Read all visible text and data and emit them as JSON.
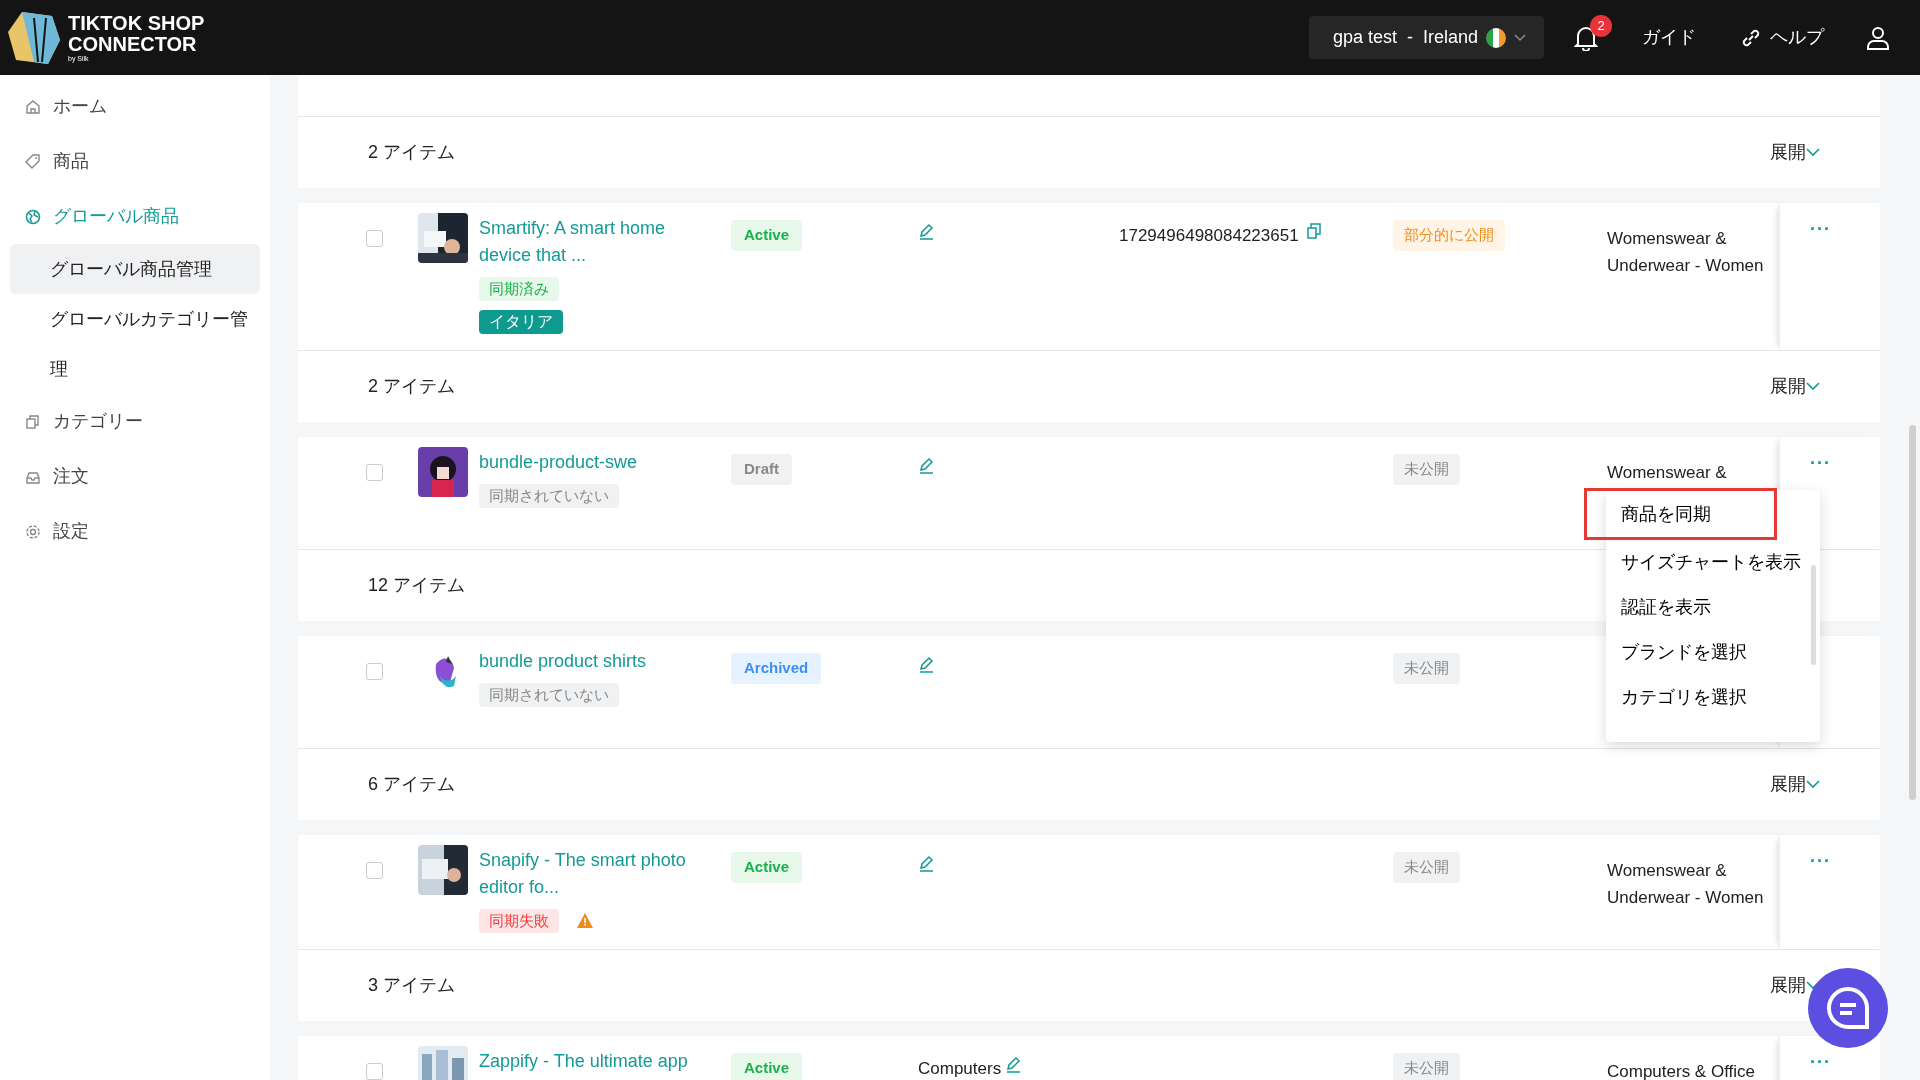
{
  "header": {
    "logo_line1": "TIKTOK SHOP",
    "logo_line2": "CONNECTOR",
    "logo_tagline": "by Silk",
    "store": "gpa test  -  Ireland",
    "notification_count": "2",
    "guide": "ガイド",
    "help": "ヘルプ"
  },
  "sidebar": {
    "items": [
      {
        "label": "ホーム",
        "selected": false
      },
      {
        "label": "商品",
        "selected": false
      },
      {
        "label": "グローバル商品",
        "selected": true,
        "expanded": true,
        "children": [
          {
            "label": "グローバル商品管理",
            "selected": true
          },
          {
            "label": "グローバルカテゴリー管理",
            "selected": false
          }
        ]
      },
      {
        "label": "カテゴリー",
        "selected": false
      },
      {
        "label": "注文",
        "selected": false
      },
      {
        "label": "設定",
        "selected": false
      }
    ]
  },
  "groups": [
    {
      "count": "2 アイテム",
      "expand": "展開",
      "product": {
        "name": "Smartify: A smart home device that ...",
        "checked": false,
        "tags": [
          {
            "label": "同期済み",
            "kind": "synced"
          },
          {
            "label": "イタリア",
            "kind": "country"
          }
        ],
        "status": {
          "label": "Active",
          "kind": "active"
        },
        "id": "1729496498084223651",
        "publish": {
          "label": "部分的に公開",
          "kind": "partial"
        },
        "category": "Womenswear & Underwear - Women",
        "more": "···"
      }
    },
    {
      "count": "2 アイテム",
      "expand": "展開",
      "product": {
        "name": "bundle-product-swe",
        "checked": false,
        "tags": [
          {
            "label": "同期されていない",
            "kind": "not_synced"
          }
        ],
        "status": {
          "label": "Draft",
          "kind": "draft"
        },
        "publish": {
          "label": "未公開",
          "kind": "unpublished"
        },
        "category": "Womenswear &",
        "more": "···",
        "menu": {
          "items": [
            {
              "label": "商品を同期",
              "highlighted": true
            },
            {
              "label": "サイズチャートを表示",
              "highlighted": false
            },
            {
              "label": "認証を表示",
              "highlighted": false
            },
            {
              "label": "ブランドを選択",
              "highlighted": false
            },
            {
              "label": "カテゴリを選択",
              "highlighted": false
            }
          ]
        }
      }
    },
    {
      "count": "12 アイテム",
      "product": {
        "name": "bundle product shirts",
        "checked": false,
        "tags": [
          {
            "label": "同期されていない",
            "kind": "not_synced"
          }
        ],
        "status": {
          "label": "Archived",
          "kind": "archived"
        },
        "publish": {
          "label": "未公開",
          "kind": "unpublished"
        }
      }
    },
    {
      "count": "6 アイテム",
      "expand": "展開",
      "product": {
        "name": "Snapify - The smart photo editor fo...",
        "checked": false,
        "tags": [
          {
            "label": "同期失敗",
            "kind": "failed"
          }
        ],
        "warning": true,
        "status": {
          "label": "Active",
          "kind": "active"
        },
        "publish": {
          "label": "未公開",
          "kind": "unpublished"
        },
        "category": "Womenswear & Underwear - Women",
        "more": "···"
      }
    },
    {
      "count": "3 アイテム",
      "expand": "展開",
      "product": {
        "name": "Zappify - The ultimate app",
        "checked": false,
        "status": {
          "label": "Active",
          "kind": "active"
        },
        "edit_label": "Computers",
        "publish": {
          "label": "未公開",
          "kind": "unpublished"
        },
        "category": "Computers & Office",
        "more": "···"
      }
    }
  ]
}
